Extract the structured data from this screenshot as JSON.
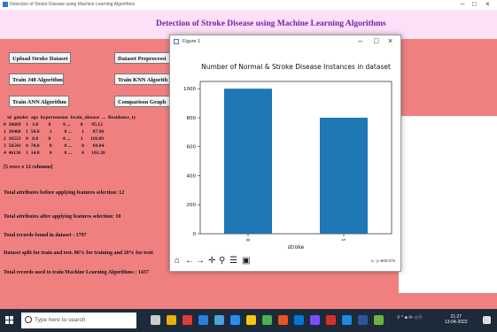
{
  "window": {
    "title": "Detection of Stroke Disease using Machine Learning Algorithms",
    "controls": [
      "–",
      "□",
      "×"
    ]
  },
  "app": {
    "heading": "Detection of Stroke Disease using Machine Learning Algorithms"
  },
  "buttons": {
    "upload": "Upload Stroke Dataset",
    "preprocess": "Dataset Preprocessi",
    "j48": "Train J48 Algorithm",
    "knn": "Train KNN Algorith",
    "ann": "Train ANN Algorithm",
    "comparison": "Comparison Graph"
  },
  "output": {
    "df_header": "   id  gender  age  hypertension  brain_disease  ...  Residence_ty",
    "df_rows": [
      "0  30669    1   3.0        0          0 ...        0       95.12",
      "1  30468    1  58.0        1          0 ...        1       87.96",
      "2  16523    0   8.0        0          0 ...        1      110.89",
      "3  56543    0  70.0        0          0 ...        0       69.04",
      "4  46136    1  14.0        0          0 ...        0      161.28"
    ],
    "shape": "[5 rows x 12 columns]",
    "attrs_before": "Total attributes before applying features selection: 12",
    "attrs_after": "Total attributes after applying features selection: 10",
    "records_found": "Total records found in dataset : 1797",
    "split": "Dataset split for train and test. 80% for training and 20% for testi",
    "train_records": "Total records used to train Machine Learning Algorithms : 1437"
  },
  "figure": {
    "window_title": "Figure 1",
    "controls": [
      "–",
      "□",
      "×"
    ],
    "coords": "x= y=800.075"
  },
  "chart_data": {
    "type": "bar",
    "title": "Number of Normal & Stroke Disease Instances in dataset",
    "categories": [
      "0",
      "1"
    ],
    "values": [
      1000,
      800
    ],
    "xlabel": "stroke",
    "ylabel": "",
    "ylim": [
      0,
      1050
    ],
    "yticks": [
      0,
      200,
      400,
      600,
      800,
      1000
    ],
    "bar_color": "#1f77b4",
    "grid": false
  },
  "taskbar": {
    "search_placeholder": "Type here to search",
    "time": "21:27",
    "date": "13-04-2022"
  },
  "colors": {
    "app_background": "#f08080",
    "header_background": "#fbe0f8",
    "title_color": "#7a1fa8",
    "taskbar": "#1c2a3a"
  }
}
